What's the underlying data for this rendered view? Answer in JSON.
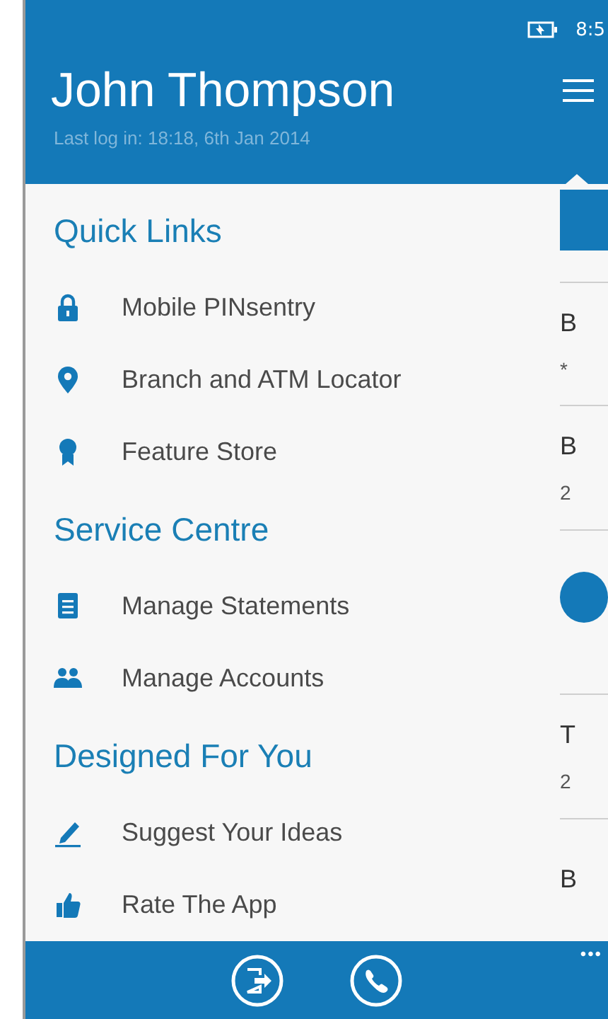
{
  "status_bar": {
    "time": "8:5"
  },
  "header": {
    "title": "John Thompson",
    "subtitle": "Last log in: 18:18, 6th Jan 2014"
  },
  "sections": [
    {
      "title": "Quick Links",
      "items": [
        {
          "label": "Mobile PINsentry"
        },
        {
          "label": "Branch and ATM Locator"
        },
        {
          "label": "Feature Store"
        }
      ]
    },
    {
      "title": "Service Centre",
      "items": [
        {
          "label": "Manage Statements"
        },
        {
          "label": "Manage Accounts"
        }
      ]
    },
    {
      "title": "Designed For You",
      "items": [
        {
          "label": "Suggest Your Ideas"
        },
        {
          "label": "Rate The App"
        }
      ]
    }
  ],
  "background_page": {
    "items": [
      {
        "kind": "button"
      },
      {
        "kind": "entry",
        "title": "B",
        "subtitle": "*"
      },
      {
        "kind": "entry",
        "title": "B",
        "subtitle": "2"
      },
      {
        "kind": "circle"
      },
      {
        "kind": "entry",
        "title": "T",
        "subtitle": "2"
      },
      {
        "kind": "entry",
        "title": "B"
      }
    ]
  },
  "app_bar": {
    "more": "•••"
  }
}
